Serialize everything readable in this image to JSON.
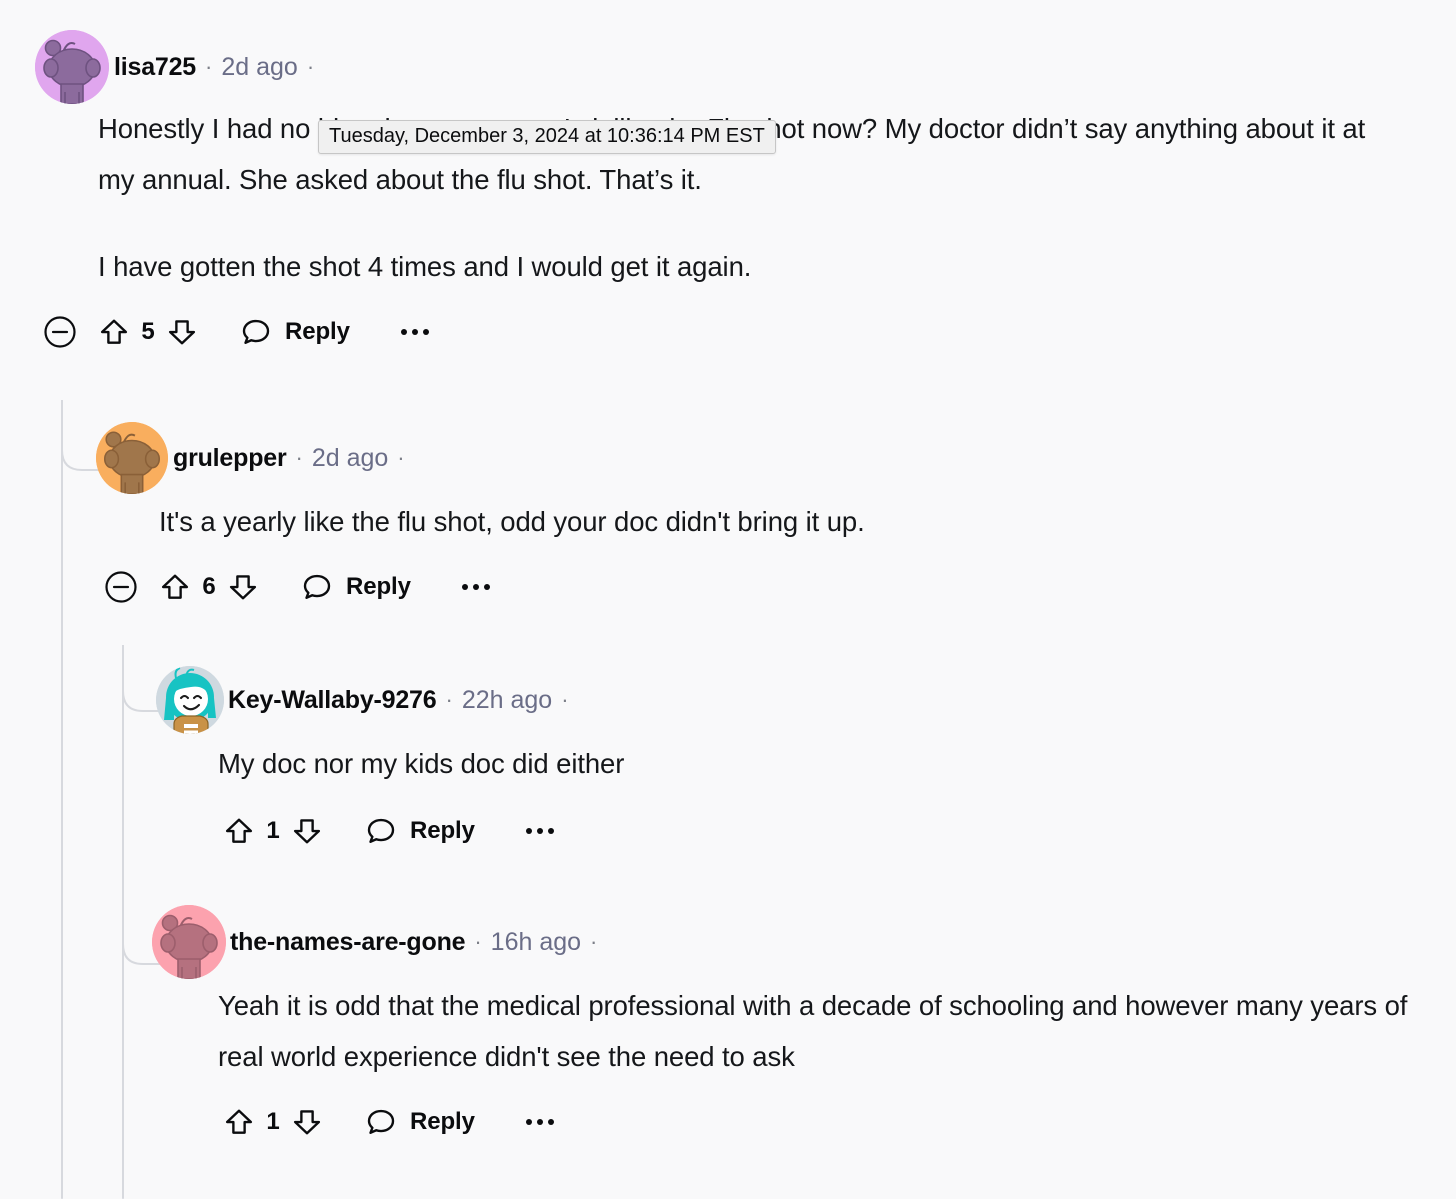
{
  "theme": {
    "background": "#F9F9FA",
    "text_color": "#15171a",
    "muted_text_color": "#6A6D87",
    "thread_line_color": "#D7D9DE",
    "tooltip_bg": "#F0F0F0"
  },
  "tooltip": {
    "text": "Tuesday, December 3, 2024 at 10:36:14 PM EST"
  },
  "comments": [
    {
      "id": "c1",
      "username": "lisa725",
      "timestamp": "2d ago",
      "separator": "·",
      "avatar": {
        "type": "snoo",
        "bg_color": "#E0A6EE",
        "snoo_color": "#8C6B9D"
      },
      "paragraphs": [
        "Honestly I had no idea there was one. Is it like the Flu shot now? My doctor didn’t say anything about it at my annual. She asked about the flu shot. That’s it.",
        "I have gotten the shot 4 times and I would get it again."
      ],
      "actions": {
        "has_collapse": true,
        "collapse_label": "collapse-thread",
        "upvote_label": "upvote",
        "downvote_label": "downvote",
        "vote_count": "5",
        "reply_label": "Reply",
        "more_label": "more-options"
      }
    },
    {
      "id": "c2",
      "username": "grulepper",
      "timestamp": "2d ago",
      "separator": "·",
      "avatar": {
        "type": "snoo",
        "bg_color": "#F9AE5E",
        "snoo_color": "#A0764B"
      },
      "paragraphs": [
        "It's a yearly like the flu shot, odd your doc didn't bring it up."
      ],
      "actions": {
        "has_collapse": true,
        "collapse_label": "collapse-thread",
        "upvote_label": "upvote",
        "downvote_label": "downvote",
        "vote_count": "6",
        "reply_label": "Reply",
        "more_label": "more-options"
      }
    },
    {
      "id": "c3",
      "username": "Key-Wallaby-9276",
      "timestamp": "22h ago",
      "separator": "·",
      "avatar": {
        "type": "custom",
        "bg_color": "#CFD9E0",
        "hair_color": "#17C3C3",
        "skin_color": "#FFFFFF",
        "shirt_color": "#C99247"
      },
      "paragraphs": [
        "My doc nor my kids doc did either"
      ],
      "actions": {
        "has_collapse": false,
        "upvote_label": "upvote",
        "downvote_label": "downvote",
        "vote_count": "1",
        "reply_label": "Reply",
        "more_label": "more-options"
      }
    },
    {
      "id": "c4",
      "username": "the-names-are-gone",
      "timestamp": "16h ago",
      "separator": "·",
      "avatar": {
        "type": "snoo",
        "bg_color": "#FCA2AE",
        "snoo_color": "#B5717F"
      },
      "paragraphs": [
        "Yeah it is odd that the medical professional with a decade of schooling and however many years of real world experience didn't see the need to ask"
      ],
      "actions": {
        "has_collapse": false,
        "upvote_label": "upvote",
        "downvote_label": "downvote",
        "vote_count": "1",
        "reply_label": "Reply",
        "more_label": "more-options"
      }
    }
  ]
}
